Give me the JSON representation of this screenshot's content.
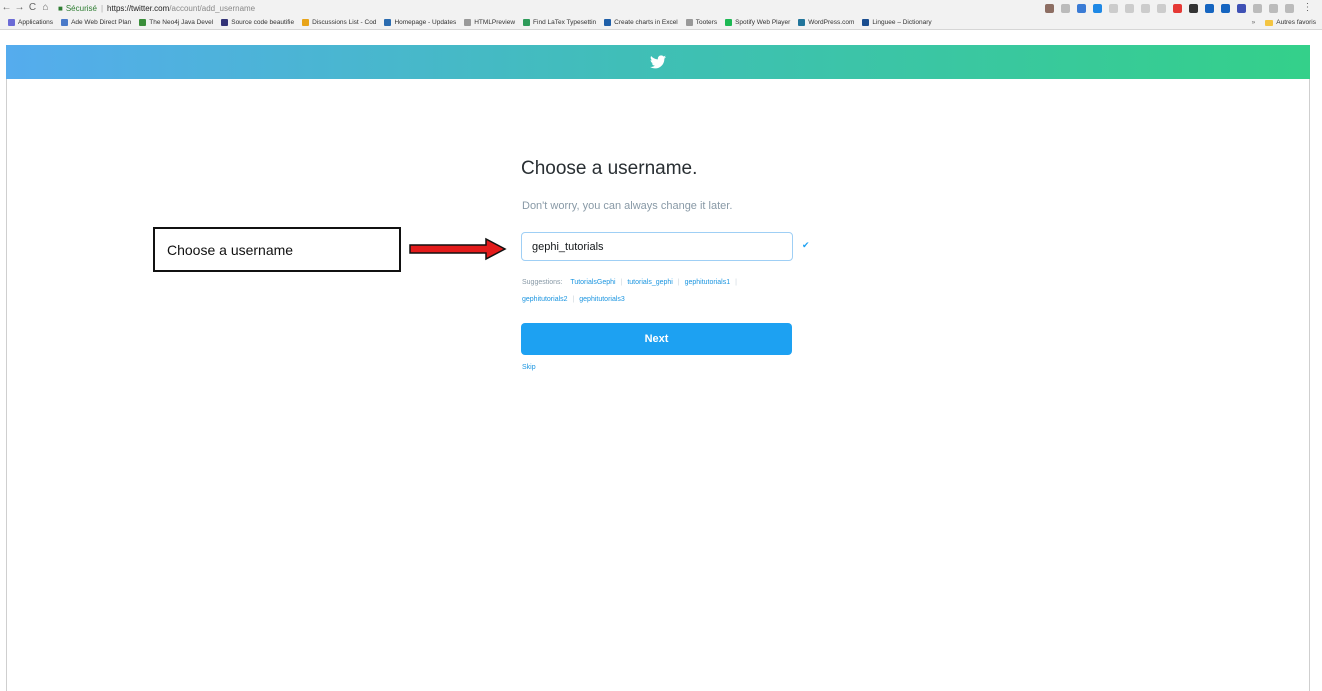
{
  "browser": {
    "secure_label": "Sécurisé",
    "url_host": "https://twitter.com",
    "url_path": "/account/add_username",
    "bookmarks": [
      {
        "label": "Applications",
        "color": "#6b6bd6"
      },
      {
        "label": "Ade Web Direct Plan",
        "color": "#4a7ac9"
      },
      {
        "label": "The Neo4j Java Devel",
        "color": "#3a8e3a"
      },
      {
        "label": "Source code beautifie",
        "color": "#333377"
      },
      {
        "label": "Discussions List - Cod",
        "color": "#e8a419"
      },
      {
        "label": "Homepage - Updates",
        "color": "#2b6cb0"
      },
      {
        "label": "HTMLPreview",
        "color": "#999999"
      },
      {
        "label": "Find LaTex Typesettin",
        "color": "#2e9b5a"
      },
      {
        "label": "Create charts in Excel",
        "color": "#1f5fa8"
      },
      {
        "label": "Tooters",
        "color": "#999999"
      },
      {
        "label": "Spotify Web Player",
        "color": "#1db954"
      },
      {
        "label": "WordPress.com",
        "color": "#21759b"
      },
      {
        "label": "Linguee – Dictionary",
        "color": "#1a4d8f"
      }
    ],
    "more_label": "»",
    "other_bookmarks": "Autres favoris"
  },
  "form": {
    "title": "Choose a username.",
    "subtitle": "Don't worry, you can always change it later.",
    "username_value": "gephi_tutorials",
    "check_icon": "checkmark-icon",
    "suggestions_label": "Suggestions:",
    "suggestions": [
      "TutorialsGephi",
      "tutorials_gephi",
      "gephitutorials1",
      "gephitutorials2",
      "gephitutorials3"
    ],
    "next_label": "Next",
    "skip_label": "Skip"
  },
  "annotation": {
    "callout_text": "Choose a username"
  },
  "colors": {
    "twitter_blue": "#1da1f2",
    "header_start": "#55acee",
    "header_end": "#34d08a",
    "arrow_red": "#e31b1b"
  }
}
